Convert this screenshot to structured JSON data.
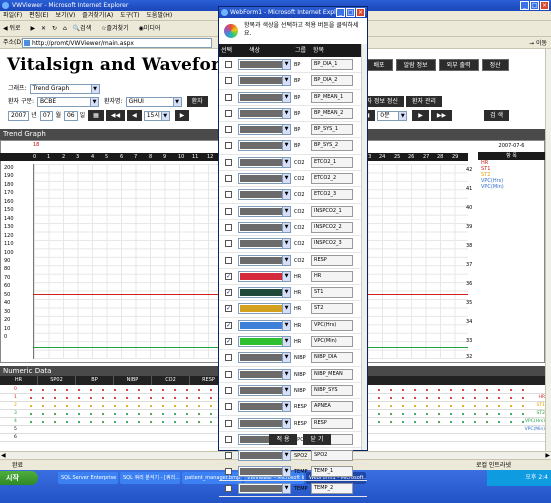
{
  "window": {
    "title": "VWViewer - Microsoft Internet Explorer"
  },
  "menu": [
    "파일(F)",
    "편집(E)",
    "보기(V)",
    "즐겨찾기(A)",
    "도구(T)",
    "도움말(H)"
  ],
  "toolbar": {
    "back": "뒤로",
    "search": "검색",
    "favorites": "즐겨찾기",
    "media": "미디어"
  },
  "address": {
    "label": "주소(D)",
    "url": "http://promt/VWViewer/main.aspx",
    "go": "이동"
  },
  "app": {
    "title": "Vitalsign and Waveform Web Viev"
  },
  "top_buttons": [
    "방",
    "배포",
    "알람 정보",
    "외부 출력",
    "정산"
  ],
  "filters": {
    "graph_label": "그래프:",
    "graph_value": "Trend Graph",
    "ward_label": "환자 구분:",
    "ward_value": "BCBE",
    "patient_label": "환자명:",
    "patient_value": "GHUI",
    "patient_btn": "환자",
    "year": "2007",
    "year_unit": "년",
    "month": "07",
    "month_unit": "월",
    "day": "06",
    "day_unit": "일",
    "hour": "15시",
    "patient_info_btn": "환자 정보 정신",
    "patient_mgmt_btn": "환자 관리",
    "minute": "0분",
    "search_btn": "검 색"
  },
  "trend": {
    "header": "Trend Graph",
    "hour_marker": "18",
    "ticks": [
      "0",
      "1",
      "2",
      "3",
      "4",
      "5",
      "6",
      "7",
      "8",
      "9",
      "10",
      "11",
      "12",
      "23",
      "24",
      "25",
      "26",
      "27",
      "28",
      "29"
    ],
    "yaxis": [
      "200",
      "190",
      "180",
      "170",
      "160",
      "150",
      "140",
      "130",
      "120",
      "110",
      "100",
      "90",
      "80",
      "70",
      "60",
      "50",
      "40",
      "30",
      "20",
      "10",
      "0"
    ],
    "right_nums": [
      "42",
      "41",
      "40",
      "39",
      "38",
      "37",
      "36",
      "35",
      "34",
      "33",
      "32"
    ],
    "date": "2007-07-6",
    "legend_head": "항 목",
    "legend": [
      {
        "label": "HR",
        "color": "#cc2222"
      },
      {
        "label": "ST1",
        "color": "#cc2222"
      },
      {
        "label": "ST2",
        "color": "#e0a000"
      },
      {
        "label": "VPC(Hrs)",
        "color": "#3070d0"
      },
      {
        "label": "VPC(Min)",
        "color": "#3070d0"
      }
    ],
    "series_colors": {
      "hr": "#d02020",
      "vpc_min": "#20a040"
    }
  },
  "numeric": {
    "header": "Numeric Data",
    "tabs": [
      "HR",
      "SP02",
      "BP",
      "NIBP",
      "CO2",
      "RESP"
    ],
    "rows": [
      {
        "idx": "0",
        "color": "#d02020"
      },
      {
        "idx": "1",
        "color": "#d02020"
      },
      {
        "idx": "2",
        "color": "#e0a000"
      },
      {
        "idx": "3",
        "color": "#20a040"
      },
      {
        "idx": "4",
        "color": "#20a040"
      },
      {
        "idx": "5",
        "color": "#bbbbbb"
      },
      {
        "idx": "6",
        "color": "#bbbbbb"
      }
    ],
    "right_labels": [
      "HR",
      "ST1",
      "ST2",
      "VPC(Hrs)",
      "VPC(Min)"
    ]
  },
  "status": {
    "left": "완료",
    "zone": "로컬 인트라넷"
  },
  "taskbar": {
    "start": "시작",
    "tasks": [
      "SQL Server Enterprise Ma...",
      "SQL 쿼리 분석기 - [쿼리...",
      "patient_manager.bmp - ...",
      "VWViewer - Microsoft Int...",
      "WebForm1 - Microsoft..."
    ],
    "clock": "오후 2:4"
  },
  "dialog": {
    "title": "WebForm1 - Microsoft Internet Explorer",
    "instruction": "항목과 색상을 선택하고 적용 버튼을 클릭하세요.",
    "head": {
      "select": "선택",
      "color": "색상",
      "group": "그룹",
      "item": "항목"
    },
    "rows": [
      {
        "checked": false,
        "color": "#6b6b6b",
        "group": "BP",
        "item": "BP_DIA_1"
      },
      {
        "checked": false,
        "color": "#6b6b6b",
        "group": "BP",
        "item": "BP_DIA_2"
      },
      {
        "checked": false,
        "color": "#6b6b6b",
        "group": "BP",
        "item": "BP_MEAN_1"
      },
      {
        "checked": false,
        "color": "#6b6b6b",
        "group": "BP",
        "item": "BP_MEAN_2"
      },
      {
        "checked": false,
        "color": "#6b6b6b",
        "group": "BP",
        "item": "BP_SYS_1"
      },
      {
        "checked": false,
        "color": "#6b6b6b",
        "group": "BP",
        "item": "BP_SYS_2"
      },
      {
        "checked": false,
        "color": "#6b6b6b",
        "group": "CO2",
        "item": "ETCO2_1"
      },
      {
        "checked": false,
        "color": "#6b6b6b",
        "group": "CO2",
        "item": "ETCO2_2"
      },
      {
        "checked": false,
        "color": "#6b6b6b",
        "group": "CO2",
        "item": "ETCO2_3"
      },
      {
        "checked": false,
        "color": "#6b6b6b",
        "group": "CO2",
        "item": "INSPCO2_1"
      },
      {
        "checked": false,
        "color": "#6b6b6b",
        "group": "CO2",
        "item": "INSPCO2_2"
      },
      {
        "checked": false,
        "color": "#6b6b6b",
        "group": "CO2",
        "item": "INSPCO2_3"
      },
      {
        "checked": false,
        "color": "#6b6b6b",
        "group": "CO2",
        "item": "RESP"
      },
      {
        "checked": true,
        "color": "#d42a3c",
        "group": "HR",
        "item": "HR"
      },
      {
        "checked": true,
        "color": "#1f4a3a",
        "group": "HR",
        "item": "ST1"
      },
      {
        "checked": true,
        "color": "#d4a020",
        "group": "HR",
        "item": "ST2"
      },
      {
        "checked": true,
        "color": "#3e7fd8",
        "group": "HR",
        "item": "VPC(Hrs)"
      },
      {
        "checked": true,
        "color": "#2ec02e",
        "group": "HR",
        "item": "VPC(Min)"
      },
      {
        "checked": false,
        "color": "#6b6b6b",
        "group": "NIBP",
        "item": "NIBP_DIA"
      },
      {
        "checked": false,
        "color": "#6b6b6b",
        "group": "NIBP",
        "item": "NIBP_MEAN"
      },
      {
        "checked": false,
        "color": "#6b6b6b",
        "group": "NIBP",
        "item": "NIBP_SYS"
      },
      {
        "checked": false,
        "color": "#6b6b6b",
        "group": "RESP",
        "item": "APNEA"
      },
      {
        "checked": false,
        "color": "#6b6b6b",
        "group": "RESP",
        "item": "RESP"
      },
      {
        "checked": false,
        "color": "#6b6b6b",
        "group": "SPO2",
        "item": "PR"
      },
      {
        "checked": false,
        "color": "#6b6b6b",
        "group": "SPO2",
        "item": "SPO2"
      },
      {
        "checked": false,
        "color": "#6b6b6b",
        "group": "TEMP",
        "item": "TEMP_1"
      },
      {
        "checked": false,
        "color": "#6b6b6b",
        "group": "TEMP",
        "item": "TEMP_2"
      }
    ],
    "apply_btn": "적 용",
    "close_btn": "닫 기"
  }
}
